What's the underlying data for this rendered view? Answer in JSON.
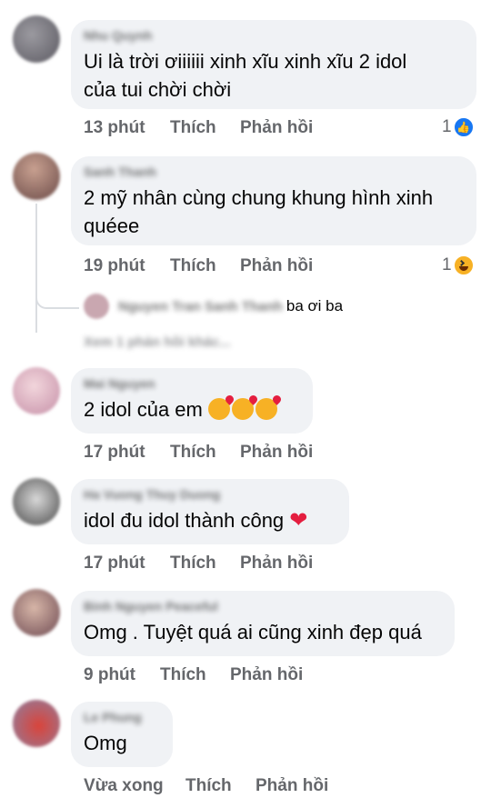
{
  "comments": [
    {
      "author": "Nhu Quynh",
      "text_lines": [
        "Ui là trời ơiiiiii xinh xĩu xinh xĩu 2 idol",
        "của tui chời chời"
      ],
      "time": "13 phút",
      "like_label": "Thích",
      "reply_label": "Phản hồi",
      "reaction_count": "1",
      "reaction_icon": "like-icon"
    },
    {
      "author": "Sanh Thanh",
      "text_lines": [
        "2 mỹ nhân cùng chung khung hình xinh",
        "quéee"
      ],
      "time": "19 phút",
      "like_label": "Thích",
      "reply_label": "Phản hồi",
      "reaction_count": "1",
      "reaction_icon": "haha-icon",
      "reply": {
        "author": "Nguyen Tran Sanh Thanh",
        "text": "ba ơi ba",
        "more": "Xem 1 phản hồi khác..."
      }
    },
    {
      "author": "Mai Nguyen",
      "text": "2 idol của em",
      "emoji": "smiling-face-with-hearts-icon x3",
      "time": "17 phút",
      "like_label": "Thích",
      "reply_label": "Phản hồi"
    },
    {
      "author": "Ha Vuong Thuy Duong",
      "text": "idol đu idol thành công",
      "emoji": "red-heart-icon",
      "time": "17 phút",
      "like_label": "Thích",
      "reply_label": "Phản hồi"
    },
    {
      "author": "Binh Nguyen Peaceful",
      "text": "Omg . Tuyệt quá ai cũng xinh đẹp quá",
      "time": "9 phút",
      "like_label": "Thích",
      "reply_label": "Phản hồi"
    },
    {
      "author": "Le Phung",
      "text": "Omg",
      "time": "Vừa xong",
      "like_label": "Thích",
      "reply_label": "Phản hồi"
    }
  ],
  "colors": {
    "bubble": "#f0f2f5",
    "action_text": "#65676b",
    "like_blue": "#1877f2",
    "heart_red": "#e41e3f"
  }
}
